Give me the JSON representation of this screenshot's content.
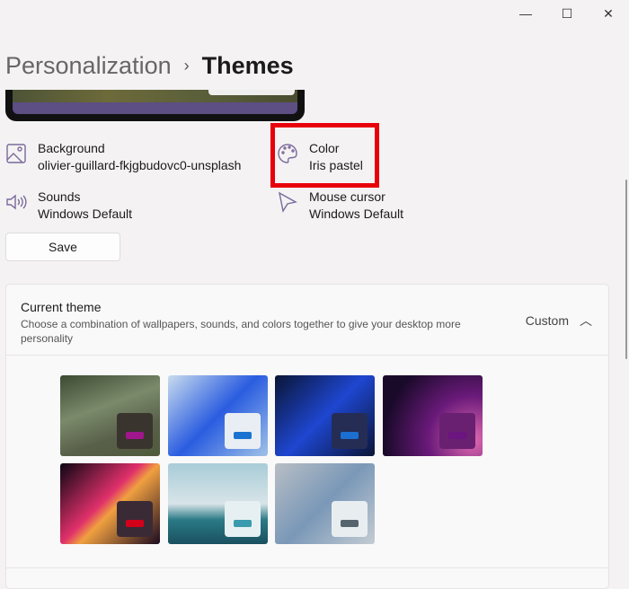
{
  "window": {
    "minimize": "—",
    "maximize": "☐",
    "close": "✕"
  },
  "breadcrumb": {
    "parent": "Personalization",
    "separator": "›",
    "current": "Themes"
  },
  "properties": [
    {
      "name": "Background",
      "value": "olivier-guillard-fkjgbudovc0-unsplash",
      "icon": "image-icon"
    },
    {
      "name": "Color",
      "value": "Iris pastel",
      "icon": "palette-icon"
    },
    {
      "name": "Sounds",
      "value": "Windows Default",
      "icon": "speaker-icon"
    },
    {
      "name": "Mouse cursor",
      "value": "Windows Default",
      "icon": "cursor-icon"
    }
  ],
  "save_label": "Save",
  "current_theme": {
    "title": "Current theme",
    "description": "Choose a combination of wallpapers, sounds, and colors together to give your desktop more personality",
    "value": "Custom"
  },
  "themes": [
    {
      "name": "forest-cabin",
      "bg": "linear-gradient(160deg,#3d4a33,#7a8a6a 40%,#59604a 70%,#4f5a3b)",
      "badge": "#3a342e",
      "accent": "#a0168c"
    },
    {
      "name": "windows-light",
      "bg": "linear-gradient(135deg,#c9dcee,#2a5ce0 50%,#9fc2e8)",
      "badge": "#e8eef4",
      "accent": "#1a73d1"
    },
    {
      "name": "windows-dark",
      "bg": "linear-gradient(135deg,#0a1535,#1e46d0 50%,#0a1535)",
      "badge": "#252d55",
      "accent": "#1a6fd1"
    },
    {
      "name": "glow",
      "bg": "radial-gradient(circle at 90% 80%,#e06ab0,#6a1a7a 40%,#1a0a2a 80%)",
      "badge": "#6a2070",
      "accent": "#6a1580"
    },
    {
      "name": "captured-motion",
      "bg": "linear-gradient(135deg,#0a0612,#e0306a 45%,#f0a040 55%,#1a0a20)",
      "badge": "#3a2a36",
      "accent": "#d4001a"
    },
    {
      "name": "flow",
      "bg": "linear-gradient(180deg,#a8ccd8,#d8e4e8 50%,#2a7a86 70%,#1a5060)",
      "badge": "#e6f0f2",
      "accent": "#3a9aae"
    },
    {
      "name": "sunrise",
      "bg": "linear-gradient(135deg,#b8bec4,#7a98b8 50%,#c4ccd2)",
      "badge": "#e8eef0",
      "accent": "#56646e"
    }
  ]
}
